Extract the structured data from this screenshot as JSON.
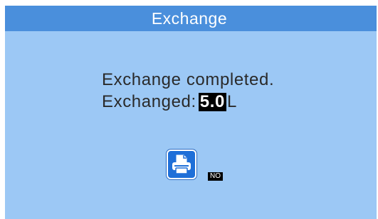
{
  "title": "Exchange",
  "message": {
    "line1": "Exchange completed.",
    "line2_label": "Exchanged:",
    "value": "5.0",
    "unit": "L"
  },
  "print_button": {
    "icon": "printer-icon"
  },
  "print_state": "NO",
  "colors": {
    "screen_background": "#9cc8f5",
    "title_bar": "#4a8fdc",
    "button": "#1f6fd8"
  }
}
